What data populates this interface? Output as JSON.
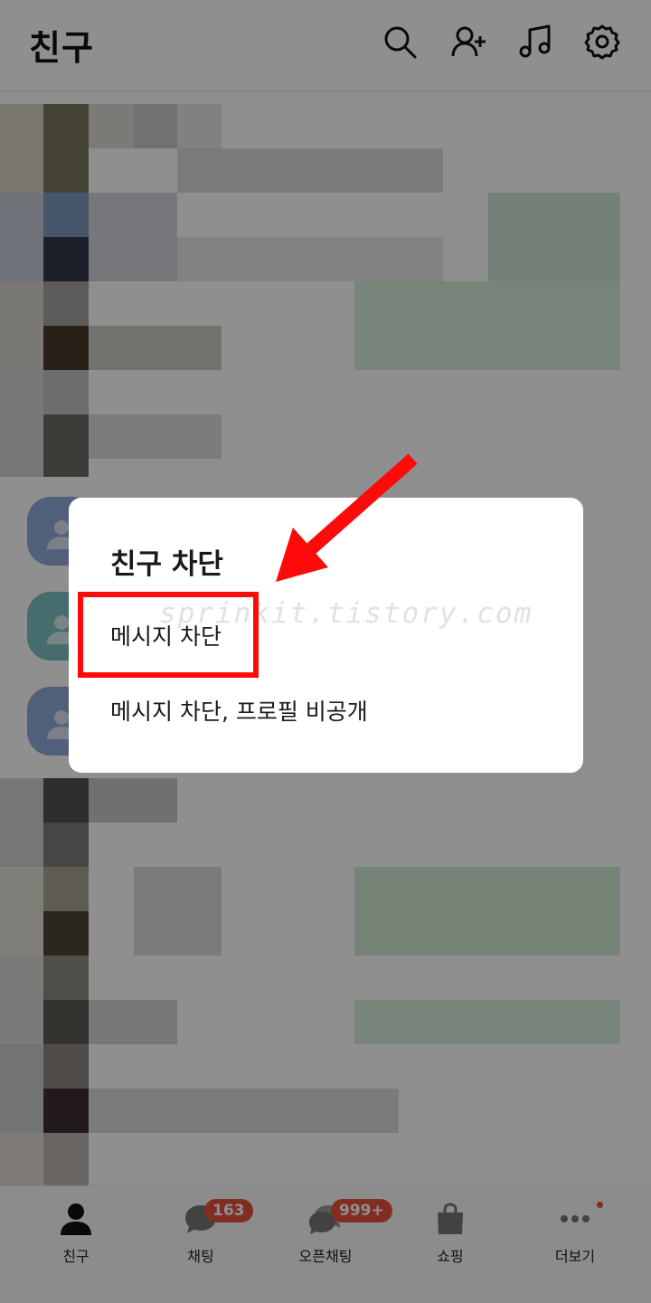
{
  "header": {
    "title": "친구",
    "icons": [
      "search-icon",
      "add-friend-icon",
      "music-icon",
      "settings-icon"
    ]
  },
  "bottom_nav": {
    "items": [
      {
        "label": "친구",
        "icon": "person-icon",
        "active": true
      },
      {
        "label": "채팅",
        "icon": "chat-bubble-icon",
        "badge": "163"
      },
      {
        "label": "오픈채팅",
        "icon": "open-chat-icon",
        "badge": "999+"
      },
      {
        "label": "쇼핑",
        "icon": "shopping-bag-icon"
      },
      {
        "label": "더보기",
        "icon": "more-icon",
        "dot": true
      }
    ]
  },
  "dialog": {
    "title": "친구 차단",
    "options": [
      "메시지 차단",
      "메시지 차단, 프로필 비공개"
    ],
    "watermark": "sprinkit.tistory.com"
  },
  "annotation": {
    "color": "#ff0a0a"
  },
  "colors": {
    "badge": "#e8503e",
    "dim_overlay": "rgba(0,0,0,0.44)"
  }
}
